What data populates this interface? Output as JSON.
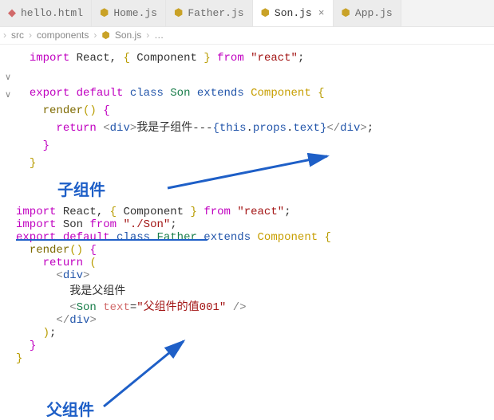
{
  "tabs": [
    {
      "label": "hello.html",
      "icon": "html"
    },
    {
      "label": "Home.js",
      "icon": "js"
    },
    {
      "label": "Father.js",
      "icon": "js"
    },
    {
      "label": "Son.js",
      "icon": "js",
      "active": true
    },
    {
      "label": "App.js",
      "icon": "js"
    }
  ],
  "breadcrumb": {
    "src": "src",
    "components": "components",
    "file": "Son.js",
    "ellipsis": "…"
  },
  "code1": {
    "import": "import",
    "react": "React",
    "component": "Component",
    "from": "from",
    "react_str": "\"react\"",
    "export": "export",
    "default": "default",
    "class": "class",
    "son": "Son",
    "extends": "extends",
    "render": "render",
    "return": "return",
    "div_open": "div",
    "div_close": "div",
    "text_cn": "我是子组件---",
    "this": "this",
    "props": "props",
    "text": "text"
  },
  "label1": "子组件",
  "code2": {
    "import": "import",
    "react": "React",
    "component": "Component",
    "from": "from",
    "react_str": "\"react\"",
    "son": "Son",
    "son_path": "\"./Son\"",
    "export": "export",
    "default": "default",
    "class": "class",
    "father": "Father",
    "extends": "extends",
    "render": "render",
    "return": "return",
    "div": "div",
    "text_cn": "我是父组件",
    "attr_text": "text",
    "attr_val": "\"父组件的值001\""
  },
  "label2": "父组件"
}
